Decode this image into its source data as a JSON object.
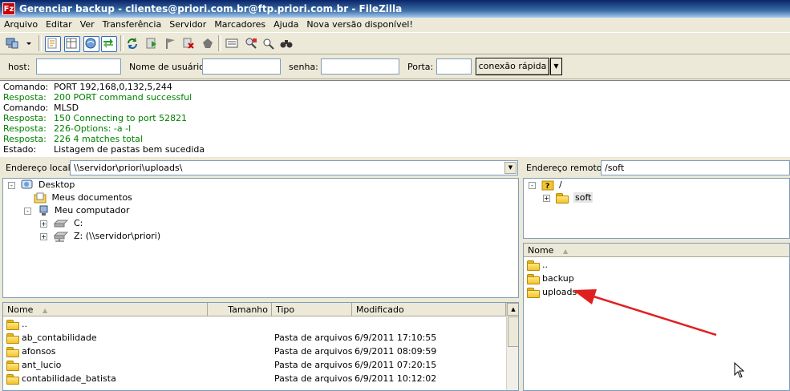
{
  "window": {
    "title": "Gerenciar backup - clientes@priori.com.br@ftp.priori.com.br - FileZilla",
    "app_icon": "Fz"
  },
  "menu": [
    "Arquivo",
    "Editar",
    "Ver",
    "Transferência",
    "Servidor",
    "Marcadores",
    "Ajuda",
    "Nova versão disponível!"
  ],
  "toolbar": {
    "buttons": [
      "site-manager-icon",
      "dropdown-arrow-icon",
      "message-log-icon",
      "local-tree-icon",
      "remote-tree-icon",
      "transfer-queue-icon",
      "refresh-icon",
      "process-queue-icon",
      "cancel-icon",
      "disconnect-icon",
      "reconnect-icon",
      "filter-icon",
      "compare-icon",
      "search-icon"
    ]
  },
  "quickconnect": {
    "host_label": "host:",
    "user_label": "Nome de usuário:",
    "pass_label": "senha:",
    "port_label": "Porta:",
    "host_value": "",
    "user_value": "",
    "pass_value": "",
    "port_value": "",
    "button": "conexão rápida"
  },
  "log": [
    {
      "type": "Comando:",
      "text": "PORT 192,168,0,132,5,244",
      "kind": "cmd"
    },
    {
      "type": "Resposta:",
      "text": "200 PORT command successful",
      "kind": "resp"
    },
    {
      "type": "Comando:",
      "text": "MLSD",
      "kind": "cmd"
    },
    {
      "type": "Resposta:",
      "text": "150 Connecting to port 52821",
      "kind": "resp"
    },
    {
      "type": "Resposta:",
      "text": "226-Options: -a -l",
      "kind": "resp"
    },
    {
      "type": "Resposta:",
      "text": "226 4 matches total",
      "kind": "resp"
    },
    {
      "type": "Estado:",
      "text": "Listagem de pastas bem sucedida",
      "kind": "status"
    }
  ],
  "local": {
    "address_label": "Endereço local:",
    "address_value": "\\\\servidor\\priori\\uploads\\",
    "tree": [
      {
        "label": "Desktop",
        "expander": "-"
      },
      {
        "label": "Meus documentos",
        "expander": ""
      },
      {
        "label": "Meu computador",
        "expander": "-"
      },
      {
        "label": "C:",
        "expander": "+"
      },
      {
        "label": "Z: (\\\\servidor\\priori)",
        "expander": "+"
      }
    ],
    "columns": [
      "Nome",
      "Tamanho",
      "Tipo",
      "Modificado"
    ],
    "files": [
      {
        "name": "..",
        "size": "",
        "type": "",
        "modified": ""
      },
      {
        "name": "ab_contabilidade",
        "size": "",
        "type": "Pasta de arquivos",
        "modified": "6/9/2011 17:10:55"
      },
      {
        "name": "afonsos",
        "size": "",
        "type": "Pasta de arquivos",
        "modified": "6/9/2011 08:09:59"
      },
      {
        "name": "ant_lucio",
        "size": "",
        "type": "Pasta de arquivos",
        "modified": "6/9/2011 07:20:15"
      },
      {
        "name": "contabilidade_batista",
        "size": "",
        "type": "Pasta de arquivos",
        "modified": "6/9/2011 10:12:02"
      }
    ]
  },
  "remote": {
    "address_label": "Endereço remoto:",
    "address_value": "/soft",
    "tree": [
      {
        "label": "/",
        "expander": "-"
      },
      {
        "label": "soft",
        "expander": "+"
      }
    ],
    "columns": [
      "Nome"
    ],
    "files": [
      {
        "name": ".."
      },
      {
        "name": "backup"
      },
      {
        "name": "uploads"
      }
    ]
  },
  "colors": {
    "response_text": "#008000",
    "annotation_arrow": "#e02020",
    "titlebar": "#0a246a"
  }
}
